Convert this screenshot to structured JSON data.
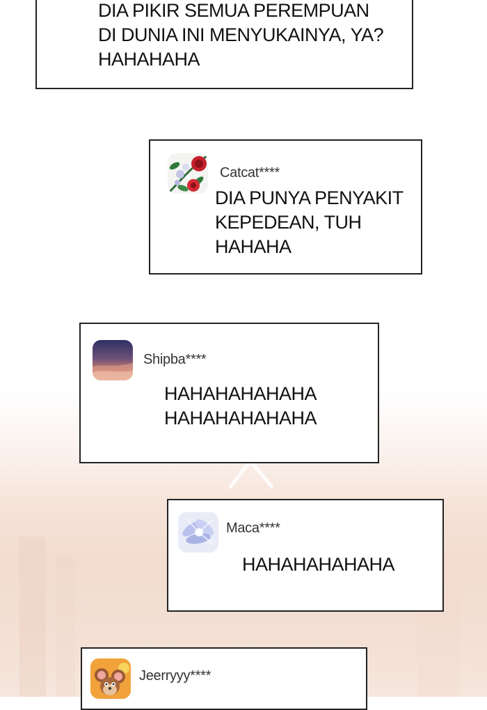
{
  "comments": [
    {
      "lines": [
        "DIA PIKIR SEMUA PEREMPUAN",
        "DI DUNIA INI MENYUKAINYA, YA?",
        "HAHAHAHA"
      ]
    },
    {
      "username": "Catcat****",
      "avatar_icon": "rose-flower-avatar-icon",
      "lines": [
        "DIA PUNYA PENYAKIT",
        "KEPEDEAN, TUH",
        "HAHAHA"
      ]
    },
    {
      "username": "Shipba****",
      "avatar_icon": "sunset-sky-avatar-icon",
      "lines": [
        "HAHAHAHAHAHA",
        "HAHAHAHAHAHA"
      ]
    },
    {
      "username": "Maca****",
      "avatar_icon": "blue-lily-avatar-icon",
      "lines": [
        "HAHAHAHAHAHA"
      ]
    },
    {
      "username": "Jeerryyy****",
      "avatar_icon": "cartoon-mouse-avatar-icon",
      "lines": []
    }
  ],
  "colors": {
    "bubble_border": "#222222",
    "bubble_fill": "#ffffff",
    "username_text": "#333333",
    "message_text": "#111111",
    "background_top": "#ffffff",
    "background_bottom": "#f3dfd3"
  }
}
